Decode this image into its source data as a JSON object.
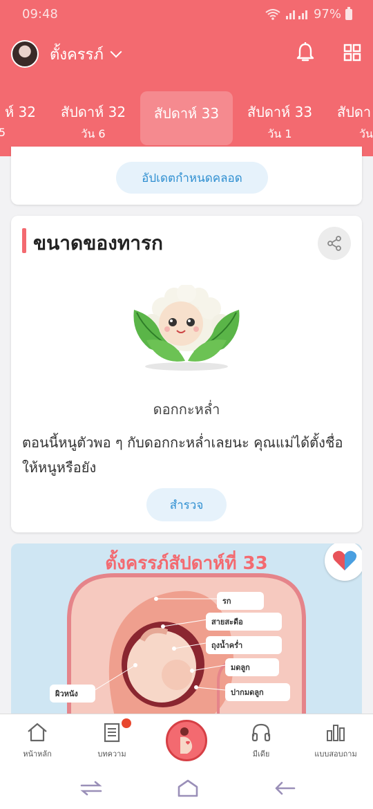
{
  "status_bar": {
    "time": "09:48",
    "battery": "97%"
  },
  "header": {
    "profile_name": "ตั้งครรภ์",
    "icons": [
      "bell-icon",
      "grid-icon"
    ]
  },
  "week_tabs": [
    {
      "week": "ห์ 32",
      "day": "5"
    },
    {
      "week": "สัปดาห์ 32",
      "day": "วัน 6"
    },
    {
      "week": "สัปดาห์ 33",
      "day": "",
      "active": true
    },
    {
      "week": "สัปดาห์ 33",
      "day": "วัน 1"
    },
    {
      "week": "สัปดา",
      "day": "วัน"
    }
  ],
  "due_date_card": {
    "button_label": "อัปเดตกำหนดคลอด"
  },
  "baby_size_card": {
    "title": "ขนาดของทารก",
    "vegetable": "ดอกกะหล่ำ",
    "description": "ตอนนี้หนูตัวพอ ๆ กับดอกกะหล่ำเลยนะ คุณแม่ได้ตั้งชื่อให้หนูหรือยัง",
    "explore_label": "สำรวจ"
  },
  "info_card": {
    "title": "ตั้งครรภ์สัปดาห์ที่ 33",
    "labels": [
      "รก",
      "สายสะดือ",
      "ถุงน้ำคร่ำ",
      "มดลูก",
      "ปากมดลูก",
      "ผิวหนัง"
    ]
  },
  "bottom_nav": [
    {
      "label": "หน้าหลัก",
      "icon": "home-icon"
    },
    {
      "label": "บทความ",
      "icon": "article-icon"
    },
    {
      "label": "",
      "icon": "pregnancy-icon"
    },
    {
      "label": "มีเดีย",
      "icon": "headphones-icon"
    },
    {
      "label": "แบบสอบถาม",
      "icon": "chart-icon"
    }
  ],
  "colors": {
    "brand": "#f36a70",
    "accent_blue": "#2f8fd1"
  }
}
